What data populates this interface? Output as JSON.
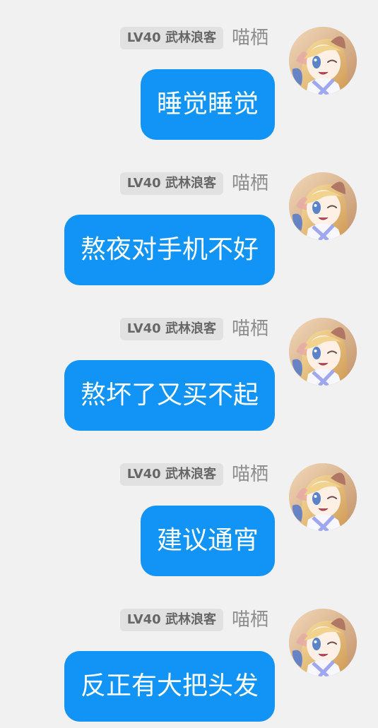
{
  "messages": [
    {
      "badge": "LV40 武林浪客",
      "nickname": "喵栖",
      "text": "睡觉睡觉",
      "avatar_icon": "anime-girl-avatar"
    },
    {
      "badge": "LV40 武林浪客",
      "nickname": "喵栖",
      "text": "熬夜对手机不好",
      "avatar_icon": "anime-girl-avatar"
    },
    {
      "badge": "LV40 武林浪客",
      "nickname": "喵栖",
      "text": "熬坏了又买不起",
      "avatar_icon": "anime-girl-avatar"
    },
    {
      "badge": "LV40 武林浪客",
      "nickname": "喵栖",
      "text": "建议通宵",
      "avatar_icon": "anime-girl-avatar"
    },
    {
      "badge": "LV40 武林浪客",
      "nickname": "喵栖",
      "text": "反正有大把头发",
      "avatar_icon": "anime-girl-avatar"
    }
  ],
  "colors": {
    "background": "#f1f1f1",
    "bubble": "#1194f6",
    "bubble_text": "#ffffff",
    "badge_background": "#e1e1e1",
    "badge_text": "#666666",
    "nickname": "#8d8d8d"
  }
}
